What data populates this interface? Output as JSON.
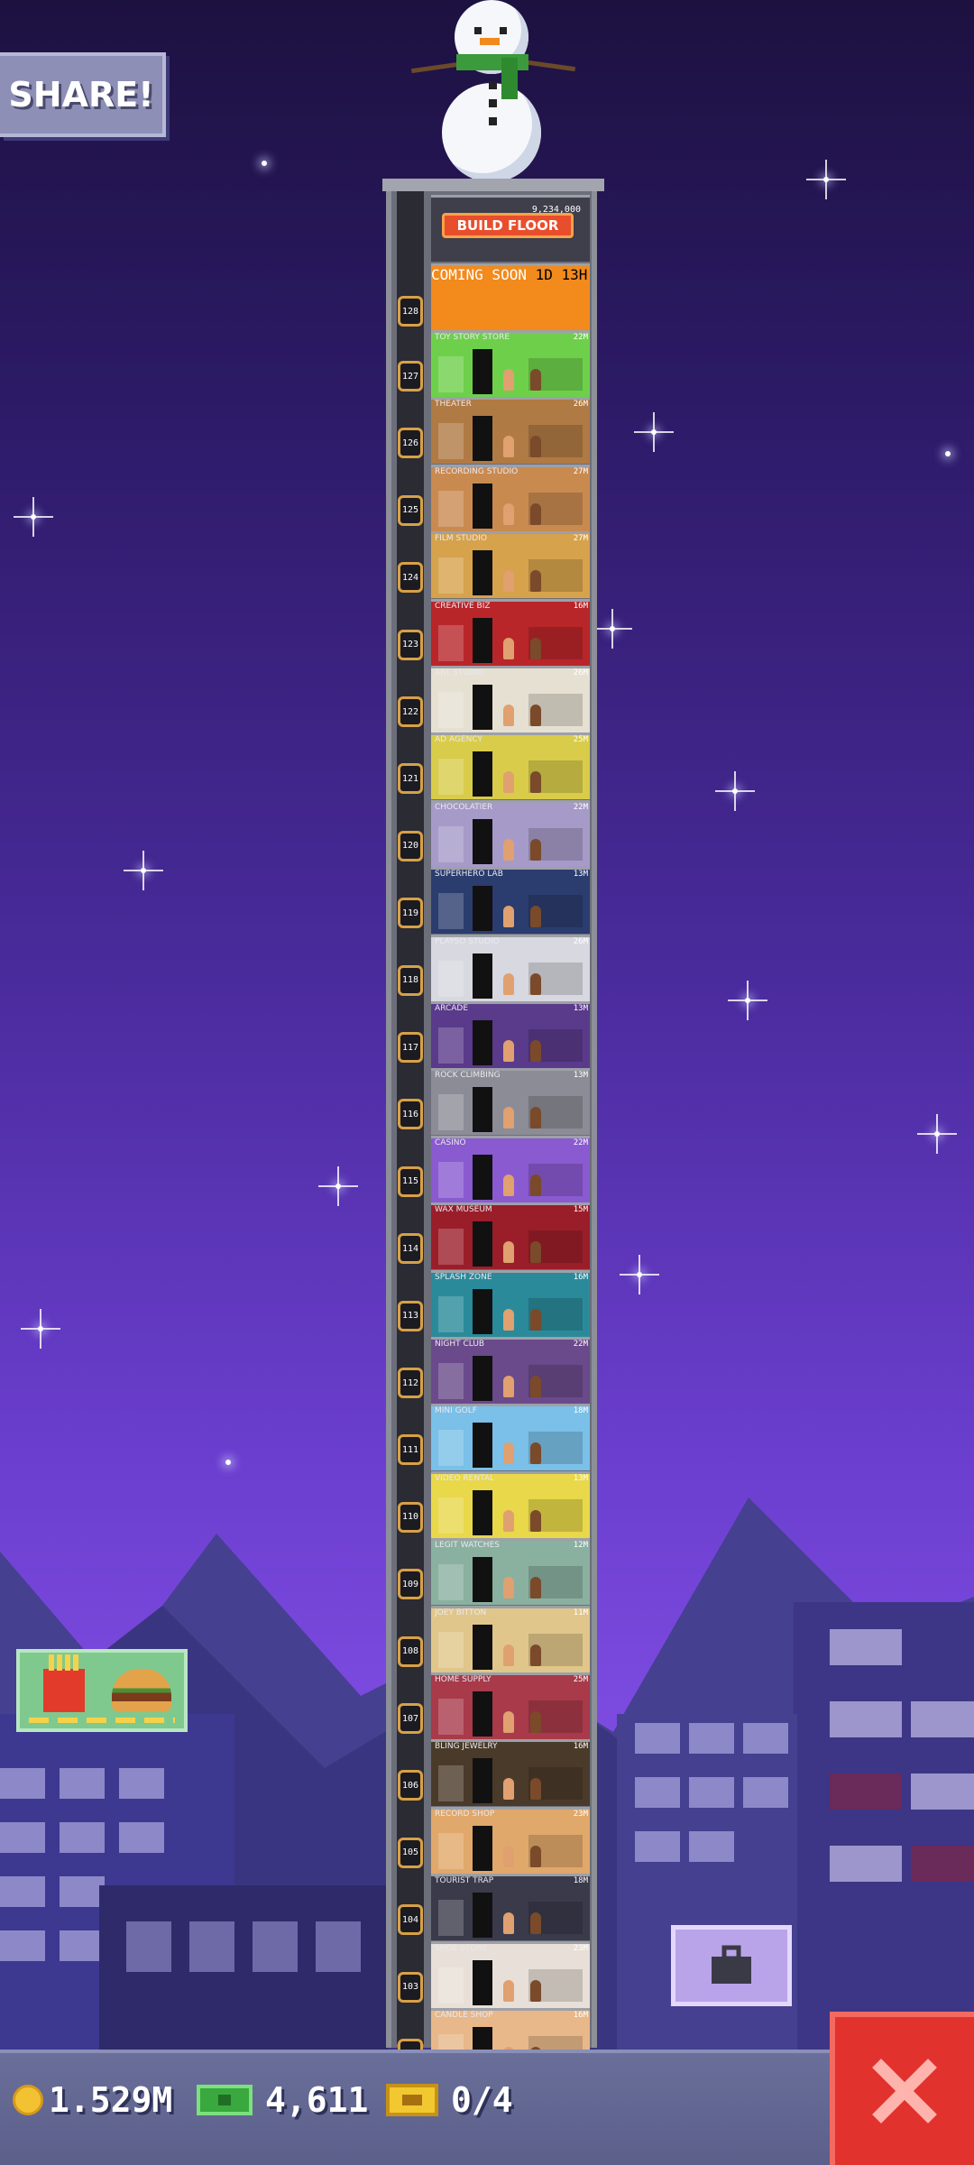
{
  "share": {
    "label": "SHARE!"
  },
  "tower": {
    "build_floor_label": "BUILD FLOOR",
    "build_cost": "9,234,000",
    "coming_soon": {
      "label": "COMING SOON",
      "time": "1D 13H"
    },
    "floors": [
      {
        "number": "127",
        "name": "TOY STORY STORE",
        "time": "22M",
        "color": "#6ed04a"
      },
      {
        "number": "126",
        "name": "THEATER",
        "time": "26M",
        "color": "#b07a44"
      },
      {
        "number": "125",
        "name": "RECORDING STUDIO",
        "time": "27M",
        "color": "#c98a50"
      },
      {
        "number": "124",
        "name": "FILM STUDIO",
        "time": "27M",
        "color": "#d6a24c"
      },
      {
        "number": "123",
        "name": "CREATIVE BIZ",
        "time": "16M",
        "color": "#b8262a"
      },
      {
        "number": "122",
        "name": "ART STUDIO",
        "time": "26M",
        "color": "#e6e0d2"
      },
      {
        "number": "121",
        "name": "AD AGENCY",
        "time": "25M",
        "color": "#d8cc4a"
      },
      {
        "number": "120",
        "name": "CHOCOLATIER",
        "time": "22M",
        "color": "#a69ac8"
      },
      {
        "number": "119",
        "name": "SUPERHERO LAB",
        "time": "13M",
        "color": "#2b3c6e"
      },
      {
        "number": "118",
        "name": "PLAYSO STUDIO",
        "time": "26M",
        "color": "#d8d8e0"
      },
      {
        "number": "117",
        "name": "ARCADE",
        "time": "13M",
        "color": "#5a3a8a"
      },
      {
        "number": "116",
        "name": "ROCK CLIMBING",
        "time": "13M",
        "color": "#8c8c96"
      },
      {
        "number": "115",
        "name": "CASINO",
        "time": "22M",
        "color": "#8a5ad0"
      },
      {
        "number": "114",
        "name": "WAX MUSEUM",
        "time": "15M",
        "color": "#9a1e2a"
      },
      {
        "number": "113",
        "name": "SPLASH ZONE",
        "time": "16M",
        "color": "#2a8a9a"
      },
      {
        "number": "112",
        "name": "NIGHT CLUB",
        "time": "22M",
        "color": "#6a4a8a"
      },
      {
        "number": "111",
        "name": "MINI GOLF",
        "time": "18M",
        "color": "#7ac0e8"
      },
      {
        "number": "110",
        "name": "VIDEO RENTAL",
        "time": "13M",
        "color": "#e8d84a"
      },
      {
        "number": "109",
        "name": "LEGIT WATCHES",
        "time": "12M",
        "color": "#8ab0a0"
      },
      {
        "number": "108",
        "name": "JOEY BITTON",
        "time": "11M",
        "color": "#e0c68a"
      },
      {
        "number": "107",
        "name": "HOME SUPPLY",
        "time": "25M",
        "color": "#a83a4a"
      },
      {
        "number": "106",
        "name": "BLING JEWELRY",
        "time": "16M",
        "color": "#4a3a2a"
      },
      {
        "number": "105",
        "name": "RECORD SHOP",
        "time": "23M",
        "color": "#e0a86a"
      },
      {
        "number": "104",
        "name": "TOURIST TRAP",
        "time": "18M",
        "color": "#3a3a4a"
      },
      {
        "number": "103",
        "name": "SHOE STORE",
        "time": "23M",
        "color": "#e8e0d8"
      },
      {
        "number": "102",
        "name": "CANDLE SHOP",
        "time": "16M",
        "color": "#e8b88a"
      }
    ]
  },
  "bottom_bar": {
    "coins": "1.529M",
    "bux": "4,611",
    "tickets": "0/4"
  },
  "colors": {
    "close_button": "#e2322e",
    "coin": "#f2c233",
    "bux": "#39a83e",
    "ticket": "#f1c830"
  },
  "icons": {
    "coin": "coin-icon",
    "bux": "bux-icon",
    "ticket": "ticket-icon",
    "bitbook": "briefcase-icon",
    "close": "close-icon"
  }
}
